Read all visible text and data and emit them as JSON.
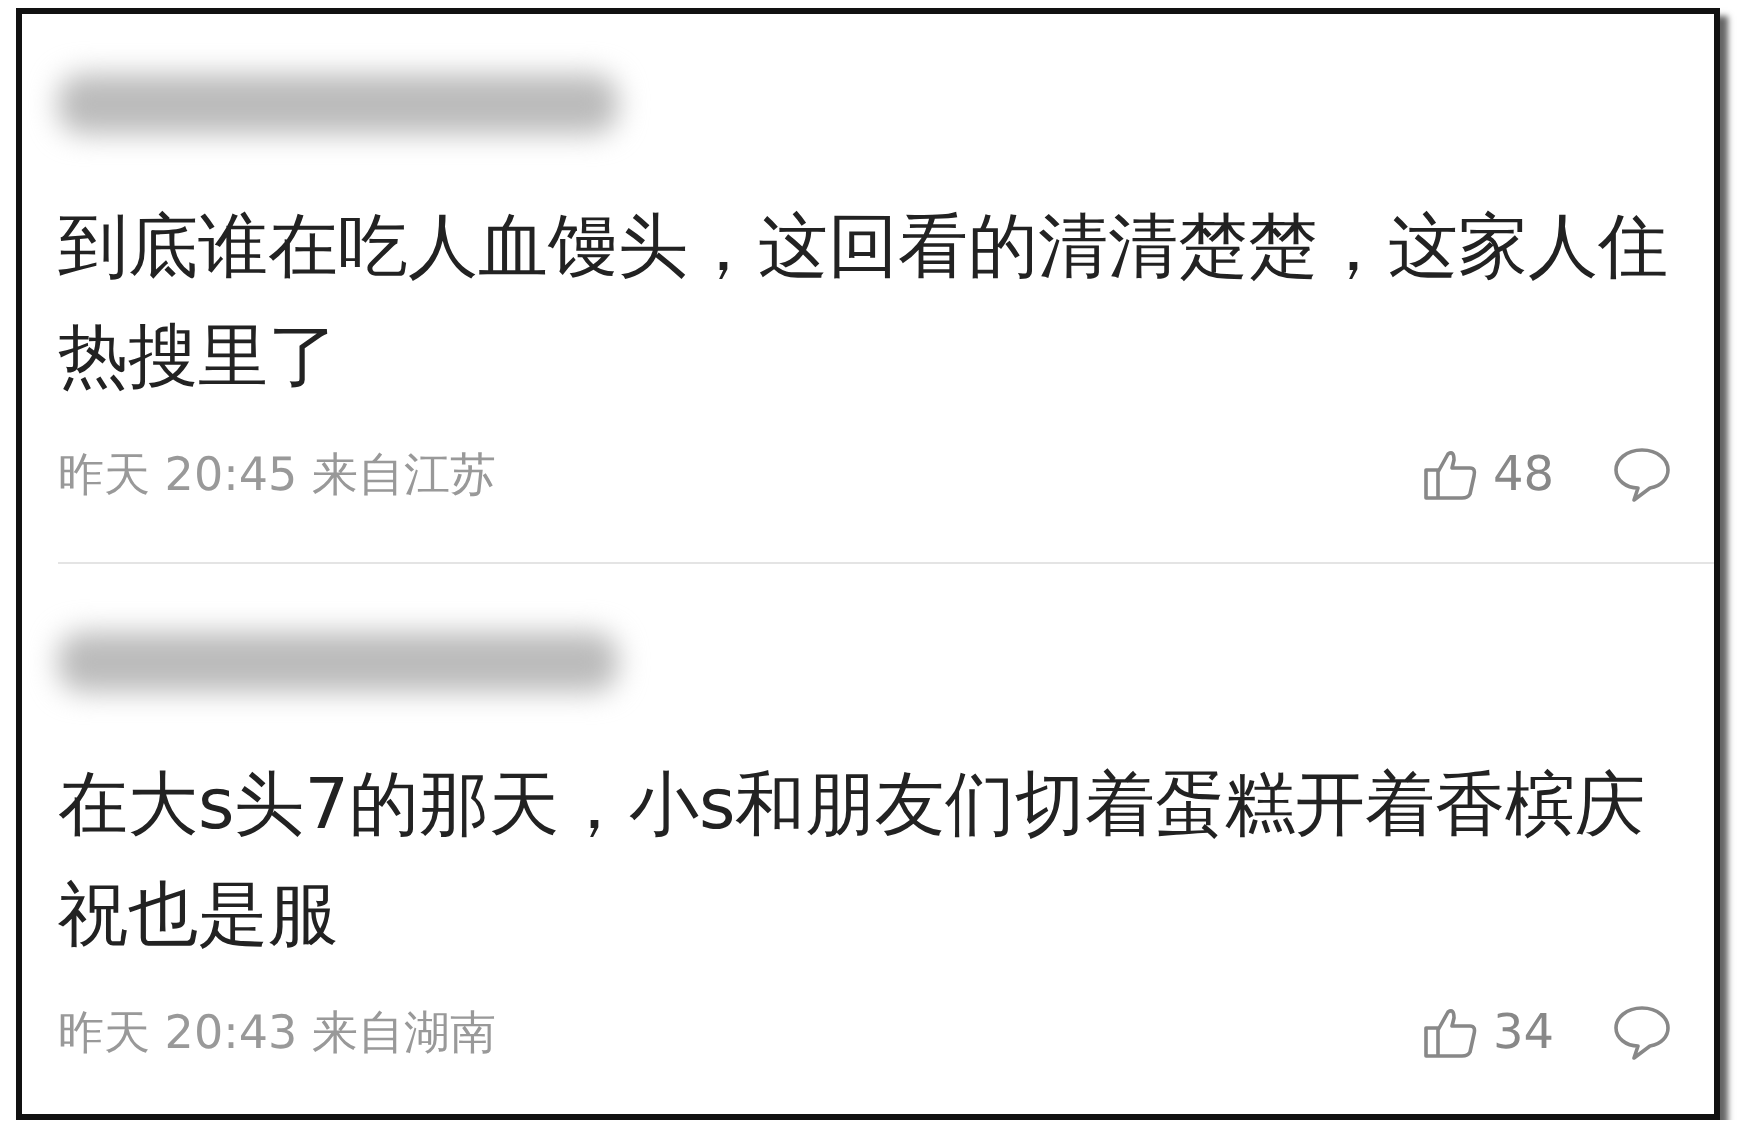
{
  "comments": [
    {
      "text": "到底谁在吃人血馒头，这回看的清清楚楚，这家人住热搜里了",
      "time": "昨天 20:45",
      "location": "来自江苏",
      "likes": "48"
    },
    {
      "text": "在大s头7的那天，小s和朋友们切着蛋糕开着香槟庆祝也是服",
      "time": "昨天 20:43",
      "location": "来自湖南",
      "likes": "34"
    }
  ]
}
